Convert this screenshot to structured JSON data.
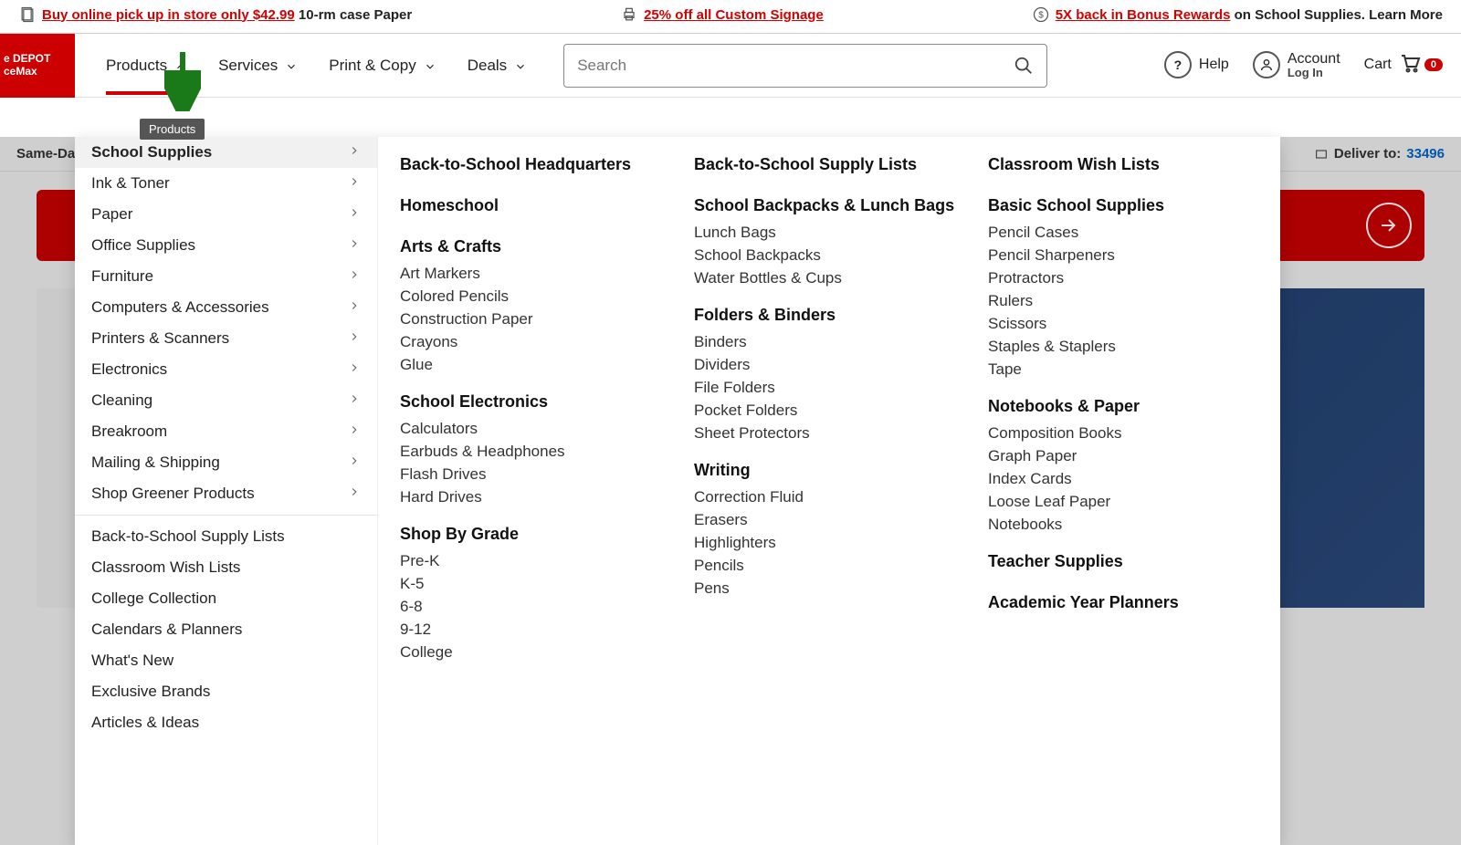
{
  "promos": [
    {
      "icon": "document-icon",
      "u": "Buy online pick up in store only $42.99",
      "plain": " 10-rm case Paper"
    },
    {
      "icon": "printer-icon",
      "u": "25% off all Custom Signage",
      "plain": ""
    },
    {
      "icon": "dollar-icon",
      "u": "5X back in Bonus Rewards",
      "plain": " on School Supplies. Learn More"
    }
  ],
  "logo": {
    "line1": "e DEPOT",
    "line2": "ceMax"
  },
  "nav": [
    {
      "label": "Products",
      "open": true
    },
    {
      "label": "Services",
      "open": false
    },
    {
      "label": "Print & Copy",
      "open": false
    },
    {
      "label": "Deals",
      "open": false
    }
  ],
  "tooltip": "Products",
  "search": {
    "placeholder": "Search"
  },
  "tools": {
    "help": "Help",
    "account": {
      "title": "Account",
      "sub": "Log In"
    },
    "cart": {
      "label": "Cart",
      "count": "0"
    }
  },
  "dim": {
    "left": "Same-Day D",
    "deliverLabel": "Deliver to:",
    "zip": "33496"
  },
  "categories_primary": [
    "School Supplies",
    "Ink & Toner",
    "Paper",
    "Office Supplies",
    "Furniture",
    "Computers & Accessories",
    "Printers & Scanners",
    "Electronics",
    "Cleaning",
    "Breakroom",
    "Mailing & Shipping",
    "Shop Greener Products"
  ],
  "categories_secondary": [
    "Back-to-School Supply Lists",
    "Classroom Wish Lists",
    "College Collection",
    "Calendars & Planners",
    "What's New",
    "Exclusive Brands",
    "Articles & Ideas"
  ],
  "mega_cols": [
    [
      {
        "heading": "Back-to-School Headquarters",
        "links": []
      },
      {
        "heading": "Homeschool",
        "links": []
      },
      {
        "heading": "Arts & Crafts",
        "links": [
          "Art Markers",
          "Colored Pencils",
          "Construction Paper",
          "Crayons",
          "Glue"
        ]
      },
      {
        "heading": "School Electronics",
        "links": [
          "Calculators",
          "Earbuds & Headphones",
          "Flash Drives",
          "Hard Drives"
        ]
      },
      {
        "heading": "Shop By Grade",
        "links": [
          "Pre-K",
          "K-5",
          "6-8",
          "9-12",
          "College"
        ]
      }
    ],
    [
      {
        "heading": "Back-to-School Supply Lists",
        "links": []
      },
      {
        "heading": "School Backpacks & Lunch Bags",
        "links": [
          "Lunch Bags",
          "School Backpacks",
          "Water Bottles & Cups"
        ]
      },
      {
        "heading": "Folders & Binders",
        "links": [
          "Binders",
          "Dividers",
          "File Folders",
          "Pocket Folders",
          "Sheet Protectors"
        ]
      },
      {
        "heading": "Writing",
        "links": [
          "Correction Fluid",
          "Erasers",
          "Highlighters",
          "Pencils",
          "Pens"
        ]
      }
    ],
    [
      {
        "heading": "Classroom Wish Lists",
        "links": []
      },
      {
        "heading": "Basic School Supplies",
        "links": [
          "Pencil Cases",
          "Pencil Sharpeners",
          "Protractors",
          "Rulers",
          "Scissors",
          "Staples & Staplers",
          "Tape"
        ]
      },
      {
        "heading": "Notebooks & Paper",
        "links": [
          "Composition Books",
          "Graph Paper",
          "Index Cards",
          "Loose Leaf Paper",
          "Notebooks"
        ]
      },
      {
        "heading": "Teacher Supplies",
        "links": []
      },
      {
        "heading": "Academic Year Planners",
        "links": []
      }
    ]
  ]
}
